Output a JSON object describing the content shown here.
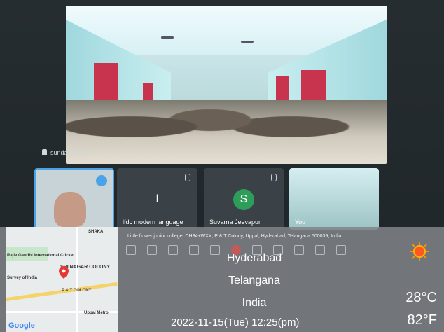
{
  "meeting": {
    "presenter_name": "sundar prasad",
    "tiles": [
      {
        "name": "",
        "avatar_letter": "",
        "avatar_color": "#000000"
      },
      {
        "name": "lfdc modern language",
        "avatar_letter": "l",
        "avatar_color": "#3a4247"
      },
      {
        "name": "Suvarna Jeevapur",
        "avatar_letter": "S",
        "avatar_color": "#2e9d5a"
      },
      {
        "name": "You",
        "avatar_letter": "",
        "avatar_color": ""
      }
    ]
  },
  "overlay": {
    "address": "Little flower junior college, CH34+WXX, P & T Colony, Uppal, Hyderabad, Telangana 500039, India",
    "city": "Hyderabad",
    "state": "Telangana",
    "country": "India",
    "datetime": "2022-11-15(Tue)  12:25(pm)",
    "temp_c": "28°C",
    "temp_f": "82°F",
    "weather_icon": "sunny-icon"
  },
  "map": {
    "labels": [
      "Rajiv Gandhi International Cricket...",
      "SRI NAGAR COLONY",
      "P & T COLONY",
      "Uppal Metro",
      "Survey of India",
      "SHAKA"
    ],
    "logo": "Google"
  }
}
